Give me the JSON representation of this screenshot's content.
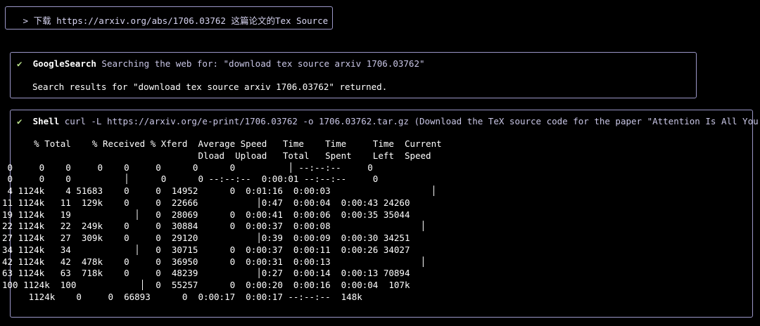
{
  "prompt": {
    "text": " > 下载 https://arxiv.org/abs/1706.03762 这篇论文的Tex Source"
  },
  "tool_calls": [
    {
      "status_icon": "✔",
      "name": "GoogleSearch",
      "description": " Searching the web for: \"download tex source arxiv 1706.03762\"",
      "result": "Search results for \"download tex source arxiv 1706.03762\" returned."
    },
    {
      "status_icon": "✔",
      "name": "Shell",
      "description": " curl -L https://arxiv.org/e-print/1706.03762 -o 1706.03762.tar.gz (Download the TeX source code for the paper \"Attention Is All You Ne…"
    }
  ],
  "shell_output": {
    "header_1": "      % Total    % Received % Xferd  Average Speed   Time    Time     Time  Current",
    "header_2": "                                     Dload  Upload   Total   Spent    Left  Speed",
    "rows": [
      " 0     0    0     0    0     0      0      0          │ --:--:--     0",
      " 0     0    0          │      0      0 --:--:--  0:00:01 --:--:--     0",
      " 4 1124k    4 51683    0     0  14952      0  0:01:16  0:00:03                   │",
      "11 1124k   11  129k    0     0  22666           │0:47  0:00:04  0:00:43 24260",
      "19 1124k   19            │   0  28069      0  0:00:41  0:00:06  0:00:35 35044",
      "22 1124k   22  249k    0     0  30884      0  0:00:37  0:00:08                 │",
      "27 1124k   27  309k    0     0  29120           │0:39  0:00:09  0:00:30 34251",
      "34 1124k   34            │   0  30715      0  0:00:37  0:00:11  0:00:26 34027",
      "42 1124k   42  478k    0     0  36950      0  0:00:31  0:00:13                 │",
      "63 1124k   63  718k    0     0  48239           │0:27  0:00:14  0:00:13 70894",
      "100 1124k  100            │  0  55257      0  0:00:20  0:00:16  0:00:04  107k",
      "     1124k    0     0  66893      0  0:00:17  0:00:17 --:--:--  148k"
    ]
  },
  "colors": {
    "background": "#000000",
    "border": "#9b97c8",
    "check": "#b9e08a",
    "text": "#ffffff"
  }
}
